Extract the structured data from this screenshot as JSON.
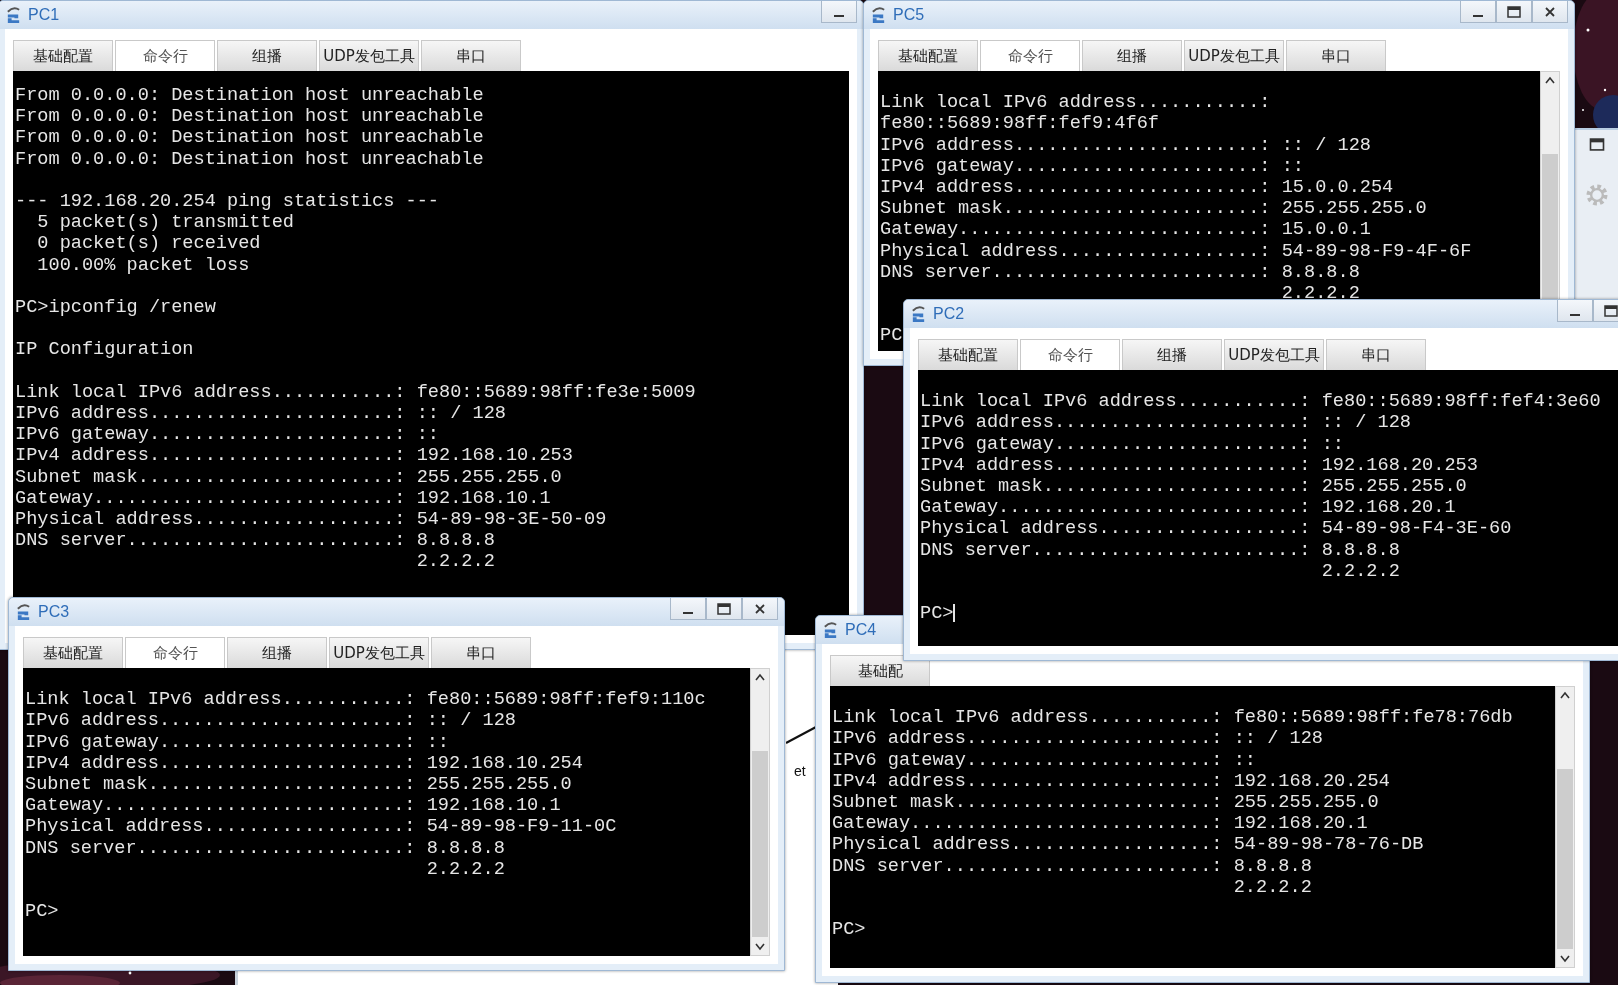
{
  "windows": [
    {
      "title": "PC1",
      "controls": [
        {
          "kind": "minimize"
        }
      ],
      "tabs": [
        {
          "label": "基础配置",
          "selected": false
        },
        {
          "label": "命令行",
          "selected": true
        },
        {
          "label": "组播",
          "selected": false
        },
        {
          "label": "UDP发包工具",
          "selected": false
        },
        {
          "label": "串口",
          "selected": false
        }
      ],
      "scrollbar": false,
      "console": {
        "scrolled": true,
        "cursor": false,
        "blocks": [
          [
            "From 0.0.0.0: Destination host unreachable",
            "From 0.0.0.0: Destination host unreachable",
            "From 0.0.0.0: Destination host unreachable",
            "From 0.0.0.0: Destination host unreachable"
          ],
          [
            "--- 192.168.20.254 ping statistics ---",
            "  5 packet(s) transmitted",
            "  0 packet(s) received",
            "  100.00% packet loss"
          ],
          [
            "PC>ipconfig /renew"
          ],
          [
            "IP Configuration"
          ],
          [
            "Link local IPv6 address...........: fe80::5689:98ff:fe3e:5009",
            "IPv6 address......................: :: / 128",
            "IPv6 gateway......................: ::",
            "IPv4 address......................: 192.168.10.253",
            "Subnet mask.......................: 255.255.255.0",
            "Gateway...........................: 192.168.10.1",
            "Physical address..................: 54-89-98-3E-50-09",
            "DNS server........................: 8.8.8.8",
            "                                    2.2.2.2"
          ]
        ]
      }
    },
    {
      "title": "PC5",
      "controls": [
        {
          "kind": "minimize"
        },
        {
          "kind": "maximize"
        },
        {
          "kind": "close"
        }
      ],
      "tabs": [
        {
          "label": "基础配置",
          "selected": false
        },
        {
          "label": "命令行",
          "selected": true
        },
        {
          "label": "组播",
          "selected": false
        },
        {
          "label": "UDP发包工具",
          "selected": false
        },
        {
          "label": "串口",
          "selected": false
        }
      ],
      "scrollbar": true,
      "console": {
        "scrolled": false,
        "cursor": false,
        "blocks": [
          [
            "Link local IPv6 address...........:",
            "fe80::5689:98ff:fef9:4f6f",
            "IPv6 address......................: :: / 128",
            "IPv6 gateway......................: ::",
            "IPv4 address......................: 15.0.0.254",
            "Subnet mask.......................: 255.255.255.0",
            "Gateway...........................: 15.0.0.1",
            "Physical address..................: 54-89-98-F9-4F-6F",
            "DNS server........................: 8.8.8.8",
            "                                    2.2.2.2"
          ],
          [
            "PC"
          ]
        ]
      }
    },
    {
      "title": "PC2",
      "controls": [
        {
          "kind": "minimize"
        },
        {
          "kind": "maximize"
        }
      ],
      "tabs": [
        {
          "label": "基础配置",
          "selected": false
        },
        {
          "label": "命令行",
          "selected": true
        },
        {
          "label": "组播",
          "selected": false
        },
        {
          "label": "UDP发包工具",
          "selected": false
        },
        {
          "label": "串口",
          "selected": false
        }
      ],
      "scrollbar": false,
      "console": {
        "scrolled": false,
        "cursor": true,
        "blocks": [
          [
            "Link local IPv6 address...........: fe80::5689:98ff:fef4:3e60",
            "IPv6 address......................: :: / 128",
            "IPv6 gateway......................: ::",
            "IPv4 address......................: 192.168.20.253",
            "Subnet mask.......................: 255.255.255.0",
            "Gateway...........................: 192.168.20.1",
            "Physical address..................: 54-89-98-F4-3E-60",
            "DNS server........................: 8.8.8.8",
            "                                    2.2.2.2"
          ],
          [
            "PC>"
          ]
        ]
      }
    },
    {
      "title": "PC3",
      "controls": [
        {
          "kind": "minimize"
        },
        {
          "kind": "maximize"
        },
        {
          "kind": "close"
        }
      ],
      "tabs": [
        {
          "label": "基础配置",
          "selected": false
        },
        {
          "label": "命令行",
          "selected": true
        },
        {
          "label": "组播",
          "selected": false
        },
        {
          "label": "UDP发包工具",
          "selected": false
        },
        {
          "label": "串口",
          "selected": false
        }
      ],
      "scrollbar": true,
      "console": {
        "scrolled": false,
        "cursor": false,
        "blocks": [
          [
            "Link local IPv6 address...........: fe80::5689:98ff:fef9:110c",
            "IPv6 address......................: :: / 128",
            "IPv6 gateway......................: ::",
            "IPv4 address......................: 192.168.10.254",
            "Subnet mask.......................: 255.255.255.0",
            "Gateway...........................: 192.168.10.1",
            "Physical address..................: 54-89-98-F9-11-0C",
            "DNS server........................: 8.8.8.8",
            "                                    2.2.2.2"
          ],
          [
            "PC>"
          ]
        ]
      }
    },
    {
      "title": "PC4",
      "tabs": [
        {
          "label": "基础配",
          "selected": false
        }
      ],
      "scrollbar": true,
      "console": {
        "scrolled": false,
        "cursor": false,
        "blocks": [
          [
            "Link local IPv6 address...........: fe80::5689:98ff:fe78:76db",
            "IPv6 address......................: :: / 128",
            "IPv6 gateway......................: ::",
            "IPv4 address......................: 192.168.20.254",
            "Subnet mask.......................: 255.255.255.0",
            "Gateway...........................: 192.168.20.1",
            "Physical address..................: 54-89-98-78-76-DB",
            "DNS server........................: 8.8.8.8",
            "                                    2.2.2.2"
          ],
          [
            "PC>"
          ]
        ]
      }
    }
  ],
  "canvas": {
    "link_label": "et"
  }
}
